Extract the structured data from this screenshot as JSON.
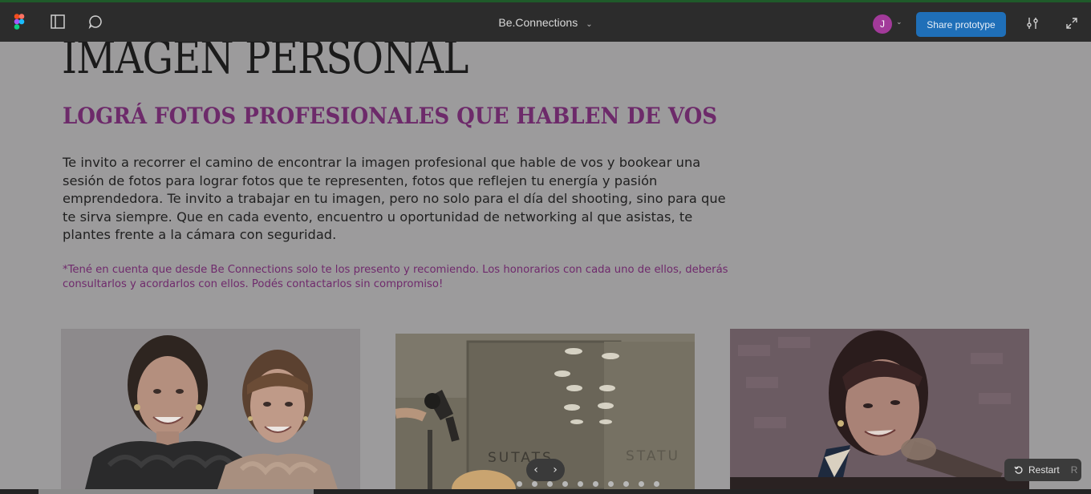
{
  "toolbar": {
    "doc_title": "Be.Connections",
    "avatar_initial": "J",
    "share_label": "Share prototype"
  },
  "content": {
    "heading": "IMAGEN PERSONAL",
    "subheading": "LOGRÁ FOTOS PROFESIONALES QUE HABLEN DE VOS",
    "paragraph": "Te invito a recorrer el camino de encontrar la imagen profesional que hable de vos y bookear una sesión de fotos para lograr fotos que te representen, fotos que reflejen tu energía y pasión emprendedora. Te invito a trabajar en tu imagen, pero no solo para el día del shooting, sino para que te sirva siempre. Que en cada evento, encuentro u oportunidad de networking al que asistas, te plantes frente a la cámara con seguridad.",
    "note": "*Tené en cuenta que desde Be Connections solo te los presento y recomiendo. Los honorarios con cada uno de ellos, deberás consultarlos y acordarlos con ellos. Podés contactarlos sin compromiso!",
    "photo2_sign": "STATU",
    "photo2_sign_mirror": "SUTATS"
  },
  "controls": {
    "prev_glyph": "‹",
    "next_glyph": "›",
    "restart_label": "Restart",
    "restart_key": "R"
  },
  "colors": {
    "accent": "#6d2a6a",
    "share": "#1f6fb8",
    "avatar": "#a23a9a"
  }
}
